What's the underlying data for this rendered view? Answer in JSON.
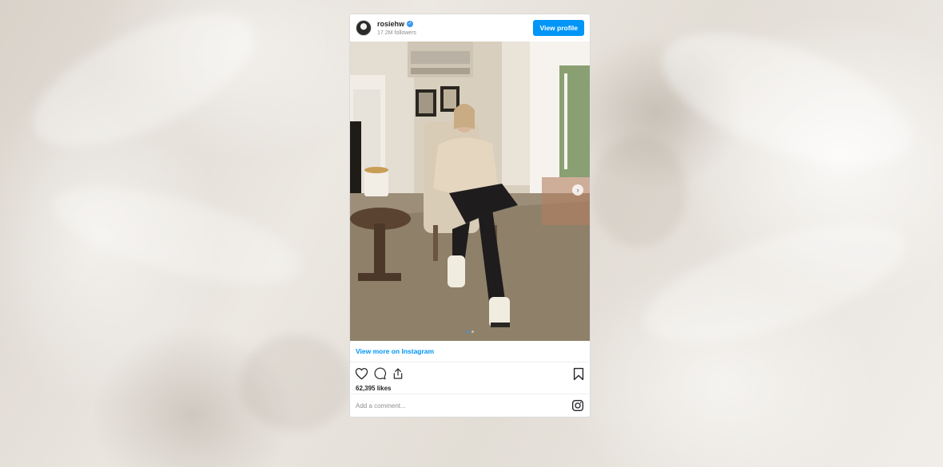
{
  "post": {
    "username": "rosiehw",
    "followers": "17.2M followers",
    "view_profile_label": "View profile",
    "view_more_label": "View more on Instagram",
    "likes": "62,395 likes",
    "comment_placeholder": "Add a comment...",
    "carousel": {
      "current": 1,
      "total": 2
    }
  },
  "icons": {
    "verified": "verified-badge-icon",
    "next": "chevron-right-icon",
    "like": "heart-icon",
    "comment": "comment-icon",
    "share": "share-icon",
    "save": "bookmark-icon",
    "instagram": "instagram-logo-icon"
  },
  "colors": {
    "accent": "#0095f6",
    "verified": "#3897f0",
    "text": "#262626",
    "muted": "#8e8e8e"
  }
}
